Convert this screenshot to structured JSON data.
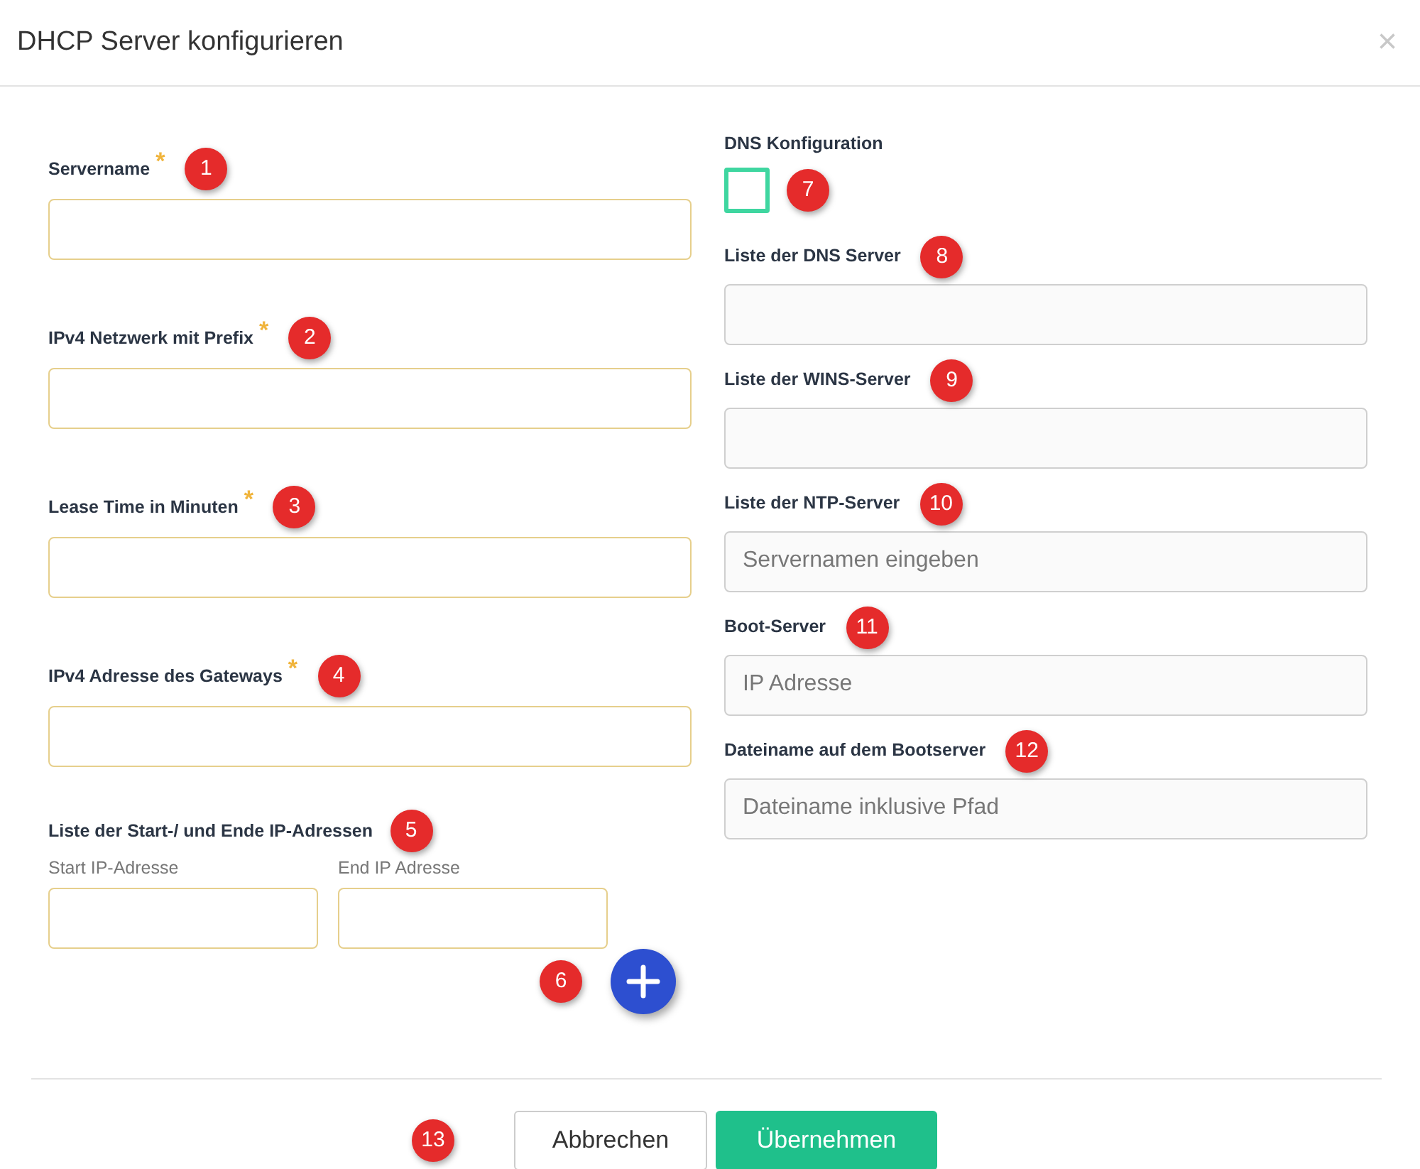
{
  "dialog": {
    "title": "DHCP Server konfigurieren",
    "close": "×"
  },
  "left_fields": [
    {
      "label": "Servername",
      "required_mark": "*",
      "callout": "1"
    },
    {
      "label": "IPv4 Netzwerk mit Prefix",
      "required_mark": "*",
      "callout": "2"
    },
    {
      "label": "Lease Time in Minuten",
      "required_mark": "*",
      "callout": "3"
    },
    {
      "label": "IPv4 Adresse des Gateways",
      "required_mark": "*",
      "callout": "4"
    }
  ],
  "ip_ranges": {
    "label": "Liste der Start-/ und Ende IP-Adressen",
    "callout": "5",
    "start_label": "Start IP-Adresse",
    "end_label": "End IP Adresse",
    "add_callout": "6"
  },
  "dns_config": {
    "label": "DNS Konfiguration",
    "checked": false,
    "callout": "7"
  },
  "right_fields": [
    {
      "label": "Liste der DNS Server",
      "callout": "8"
    },
    {
      "label": "Liste der WINS-Server",
      "callout": "9"
    },
    {
      "label": "Liste der NTP-Server",
      "callout": "10",
      "placeholder": "Servernamen eingeben"
    },
    {
      "label": "Boot-Server",
      "callout": "11",
      "placeholder": "IP Adresse"
    },
    {
      "label": "Dateiname auf dem Bootserver",
      "callout": "12",
      "placeholder": "Dateiname inklusive Pfad"
    }
  ],
  "footer": {
    "callout": "13",
    "cancel": "Abbrechen",
    "apply": "Übernehmen"
  }
}
